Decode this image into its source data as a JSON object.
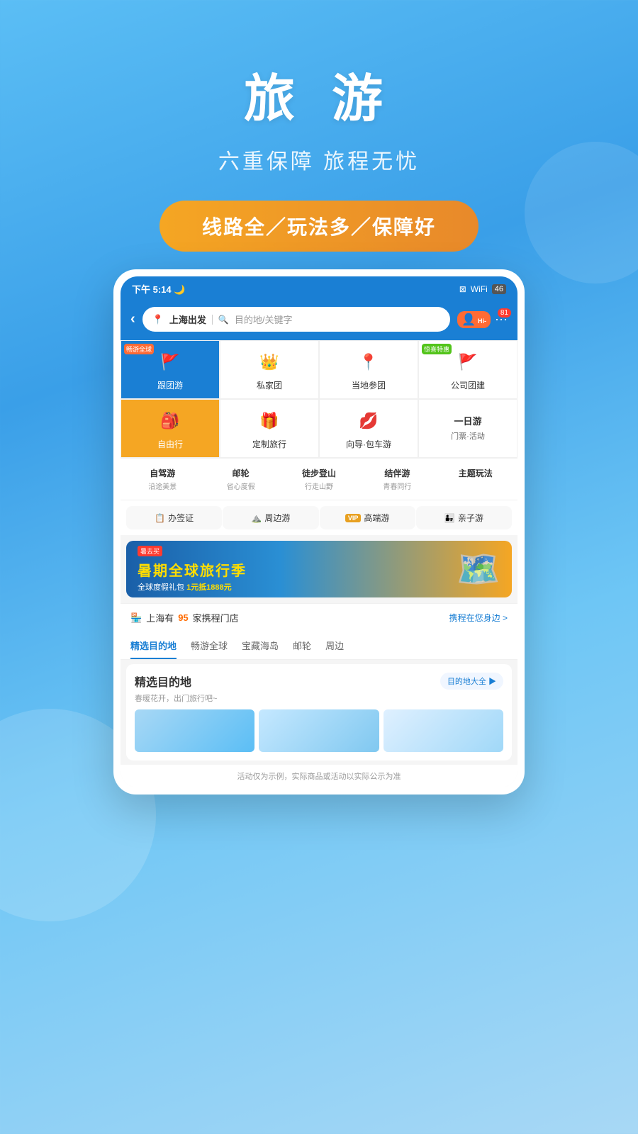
{
  "hero": {
    "title": "旅 游",
    "subtitle": "六重保障 旅程无忧",
    "badge": "线路全／玩法多／保障好"
  },
  "phone": {
    "statusBar": {
      "time": "下午 5:14",
      "moonIcon": "🌙"
    },
    "searchBar": {
      "departure": "上海出发",
      "placeholder": "目的地/关键字",
      "hiBadge": "Hi-",
      "msgCount": "81"
    },
    "menuItems": [
      {
        "id": "group-tour",
        "label": "跟团游",
        "tag": "畅游全球",
        "bg": "blue",
        "icon": "🚩"
      },
      {
        "id": "private-tour",
        "label": "私家团",
        "tag": "",
        "bg": "white",
        "icon": "👑"
      },
      {
        "id": "local-tour",
        "label": "当地参团",
        "tag": "",
        "bg": "white",
        "icon": "📍"
      },
      {
        "id": "corporate",
        "label": "公司团建",
        "tag": "惊喜特惠",
        "bg": "white",
        "icon": "🚩"
      },
      {
        "id": "free-travel",
        "label": "自由行",
        "tag": "",
        "bg": "orange",
        "icon": "🎒"
      },
      {
        "id": "custom-tour",
        "label": "定制旅行",
        "tag": "",
        "bg": "white",
        "icon": "🎁"
      },
      {
        "id": "guide-tour",
        "label": "向导·包车游",
        "tag": "",
        "bg": "white",
        "icon": "👄"
      },
      {
        "id": "day-tour",
        "label": "一日游\n门票·活动",
        "tag": "",
        "bg": "white",
        "icon": ""
      }
    ],
    "subMenu": [
      {
        "main": "自驾游",
        "sub": "沿途美景"
      },
      {
        "main": "邮轮",
        "sub": "省心度假"
      },
      {
        "main": "徒步登山",
        "sub": "行走山野"
      },
      {
        "main": "结伴游",
        "sub": "青春同行"
      },
      {
        "main": "主题玩法",
        "sub": ""
      }
    ],
    "serviceTags": [
      {
        "label": "办签证",
        "icon": "📋"
      },
      {
        "label": "周边游",
        "icon": "⛰️"
      },
      {
        "label": "高端游",
        "icon": "VIP"
      },
      {
        "label": "亲子游",
        "icon": "👨‍👧"
      }
    ],
    "banner": {
      "title": "暑期全球旅行季",
      "subtitle": "全球度假礼包",
      "promo": "1元抵1888元"
    },
    "storeInfo": {
      "prefix": "上海有",
      "count": "95",
      "suffix": "家携程门店",
      "link": "携程在您身边 >"
    },
    "tabs": [
      "精选目的地",
      "畅游全球",
      "宝藏海岛",
      "邮轮",
      "周边"
    ],
    "featured": {
      "title": "精选目的地",
      "desc": "春暖花开，出门旅行吧~",
      "btnLabel": "目的地大全 ▶"
    },
    "disclaimer": "活动仅为示例，实际商品或活动以实际公示为准"
  }
}
